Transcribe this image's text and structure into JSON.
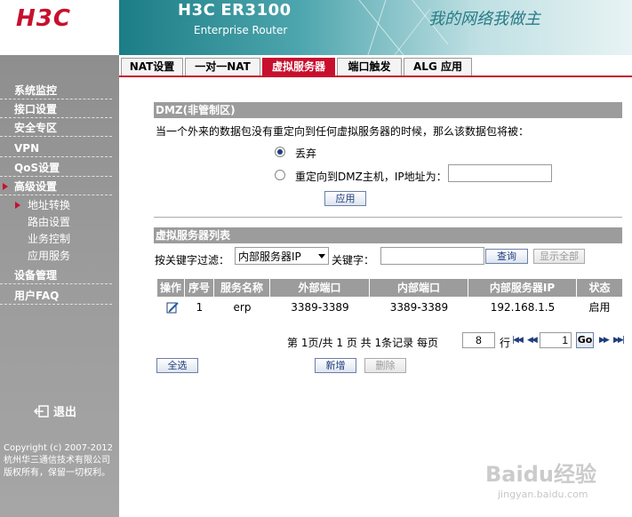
{
  "header": {
    "logo": "H3C",
    "product_name_prefix": "H3C",
    "product_name_model": "ER3100",
    "product_subtitle": "Enterprise Router",
    "slogan": "我的网络我做主"
  },
  "sidebar": {
    "items": [
      {
        "label": "系统监控"
      },
      {
        "label": "接口设置"
      },
      {
        "label": "安全专区"
      },
      {
        "label": "VPN"
      },
      {
        "label": "QoS设置"
      },
      {
        "label": "高级设置"
      },
      {
        "label": "设备管理"
      },
      {
        "label": "用户FAQ"
      }
    ],
    "sub_items": [
      {
        "label": "地址转换"
      },
      {
        "label": "路由设置"
      },
      {
        "label": "业务控制"
      },
      {
        "label": "应用服务"
      }
    ],
    "logout": "退出",
    "copyright": "Copyright (c) 2007-2012 杭州华三通信技术有限公司 版权所有，保留一切权利。"
  },
  "tabs": [
    {
      "label": "NAT设置"
    },
    {
      "label": "一对一NAT"
    },
    {
      "label": "虚拟服务器"
    },
    {
      "label": "端口触发"
    },
    {
      "label": "ALG 应用"
    }
  ],
  "dmz": {
    "title": "DMZ(非管制区)",
    "description": "当一个外来的数据包没有重定向到任何虚拟服务器的时候，那么该数据包将被：",
    "option_drop": "丢弃",
    "option_redirect": "重定向到DMZ主机，IP地址为：",
    "ip_value": "",
    "apply": "应用"
  },
  "vs_list": {
    "title": "虚拟服务器列表",
    "filter_label": "按关键字过滤：",
    "filter_field": "内部服务器IP",
    "keyword_label": "关键字：",
    "keyword_value": "",
    "search": "查询",
    "show_all": "显示全部",
    "columns": [
      "操作",
      "序号",
      "服务名称",
      "外部端口",
      "内部端口",
      "内部服务器IP",
      "状态"
    ],
    "rows": [
      {
        "index": "1",
        "name": "erp",
        "ext_port": "3389-3389",
        "int_port": "3389-3389",
        "ip": "192.168.1.5",
        "status": "启用"
      }
    ]
  },
  "pagination": {
    "text_page": "第",
    "current_page": "1",
    "text_total": "页/共",
    "total_pages": "1",
    "text_pages": "页 共",
    "total_records": "1",
    "text_records": "条记录 每页",
    "per_page": "8",
    "text_rows": "行",
    "goto_value": "1",
    "go": "Go"
  },
  "actions": {
    "select_all": "全选",
    "add": "新增",
    "delete": "删除"
  },
  "watermark": {
    "text": "Baidu经验",
    "url": "jingyan.baidu.com"
  },
  "colors": {
    "accent": "#c8102e",
    "sidebar": "#9a9a9a",
    "section_bar": "#9c9c9c"
  }
}
